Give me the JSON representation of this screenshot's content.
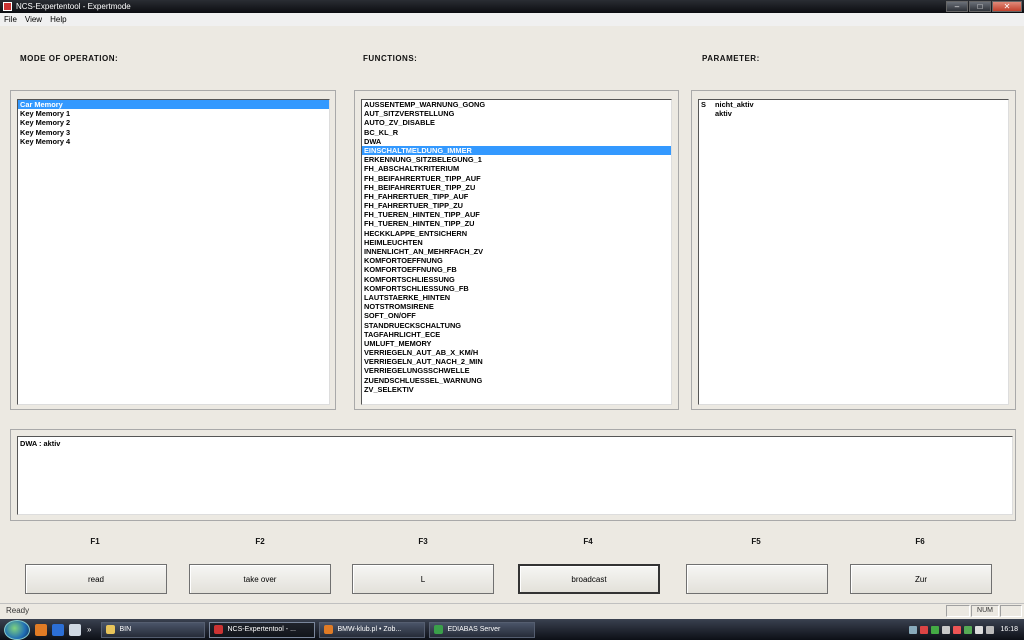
{
  "window": {
    "title": "NCS-Expertentool - Expertmode",
    "controls": {
      "minimize": "‒",
      "maximize": "□",
      "close": "✕"
    }
  },
  "menu": [
    "File",
    "View",
    "Help"
  ],
  "mode": {
    "heading": "MODE OF OPERATION:",
    "items": [
      "Car Memory",
      "Key Memory 1",
      "Key Memory 2",
      "Key Memory 3",
      "Key Memory 4"
    ],
    "selected_index": 0
  },
  "functions": {
    "heading": "FUNCTIONS:",
    "items": [
      "AUSSENTEMP_WARNUNG_GONG",
      "AUT_SITZVERSTELLUNG",
      "AUTO_ZV_DISABLE",
      "BC_KL_R",
      "DWA",
      "EINSCHALTMELDUNG_IMMER",
      "ERKENNUNG_SITZBELEGUNG_1",
      "FH_ABSCHALTKRITERIUM",
      "FH_BEIFAHRERTUER_TIPP_AUF",
      "FH_BEIFAHRERTUER_TIPP_ZU",
      "FH_FAHRERTUER_TIPP_AUF",
      "FH_FAHRERTUER_TIPP_ZU",
      "FH_TUEREN_HINTEN_TIPP_AUF",
      "FH_TUEREN_HINTEN_TIPP_ZU",
      "HECKKLAPPE_ENTSICHERN",
      "HEIMLEUCHTEN",
      "INNENLICHT_AN_MEHRFACH_ZV",
      "KOMFORTOEFFNUNG",
      "KOMFORTOEFFNUNG_FB",
      "KOMFORTSCHLIESSUNG",
      "KOMFORTSCHLIESSUNG_FB",
      "LAUTSTAERKE_HINTEN",
      "NOTSTROMSIRENE",
      "SOFT_ON/OFF",
      "STANDRUECKSCHALTUNG",
      "TAGFAHRLICHT_ECE",
      "UMLUFT_MEMORY",
      "VERRIEGELN_AUT_AB_X_KM/H",
      "VERRIEGELN_AUT_NACH_2_MIN",
      "VERRIEGELUNGSSCHWELLE",
      "ZUENDSCHLUESSEL_WARNUNG",
      "ZV_SELEKTIV"
    ],
    "selected_index": 5
  },
  "parameter": {
    "heading": "PARAMETER:",
    "rows": [
      {
        "flag": "S",
        "value": "nicht_aktiv"
      },
      {
        "flag": "",
        "value": "aktiv"
      }
    ]
  },
  "info": {
    "text": "DWA :  aktiv"
  },
  "fkeys": [
    {
      "key": "F1",
      "label": "read"
    },
    {
      "key": "F2",
      "label": "take over"
    },
    {
      "key": "F3",
      "label": "L"
    },
    {
      "key": "F4",
      "label": "broadcast"
    },
    {
      "key": "F5",
      "label": ""
    },
    {
      "key": "F6",
      "label": "Zur"
    }
  ],
  "status": {
    "text": "Ready",
    "num": "NUM"
  },
  "taskbar": {
    "chevron": "»",
    "tasks": [
      "BIN",
      "NCS-Expertentool - ...",
      "BMW-klub.pl • Zob...",
      "EDIABAS Server"
    ],
    "clock": "16:18"
  }
}
